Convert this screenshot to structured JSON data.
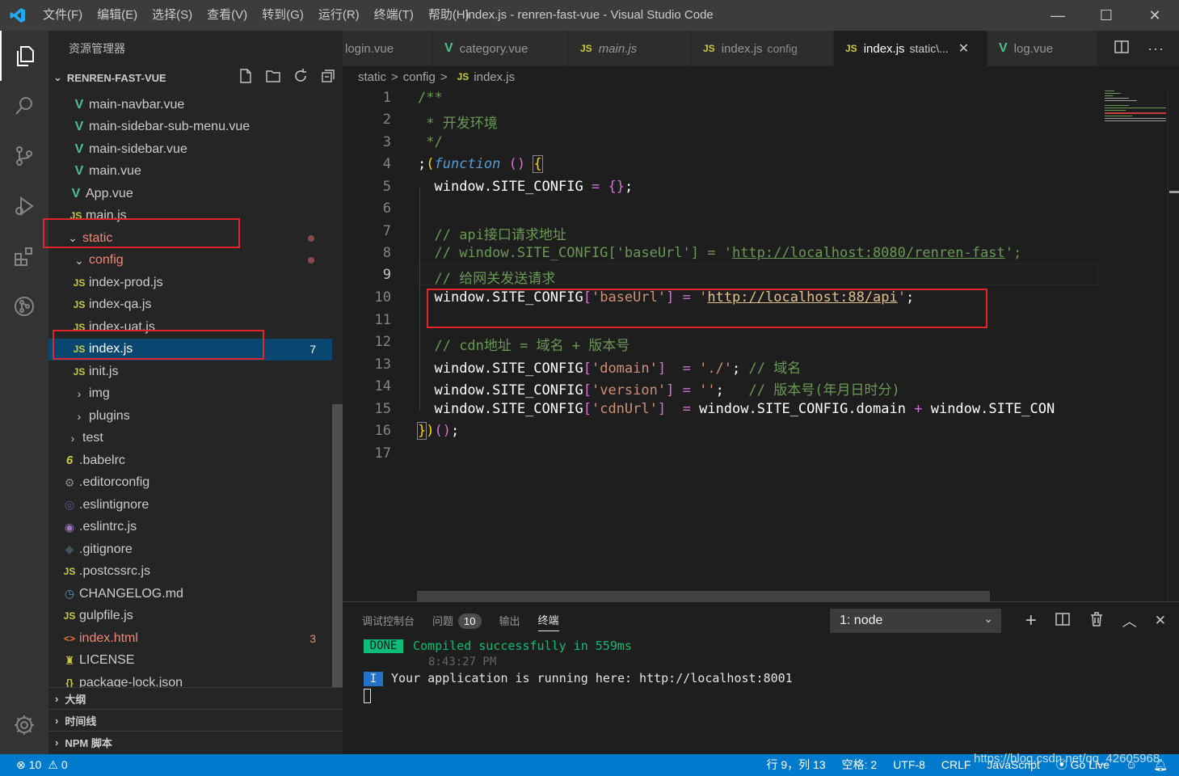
{
  "titlebar": {
    "menus": [
      "文件(F)",
      "编辑(E)",
      "选择(S)",
      "查看(V)",
      "转到(G)",
      "运行(R)",
      "终端(T)",
      "帮助(H)"
    ],
    "window_title": "index.js - renren-fast-vue - Visual Studio Code"
  },
  "activity": [
    "explorer-icon",
    "search-icon",
    "source-control-icon",
    "run-debug-icon",
    "extensions-icon",
    "git-graph-icon",
    "settings-gear-icon"
  ],
  "sidebar": {
    "header": "资源管理器",
    "project": "RENREN-FAST-VUE",
    "tree": [
      {
        "label": "main-navbar.vue",
        "icon": "V",
        "kind": "vue",
        "depth": 2
      },
      {
        "label": "main-sidebar-sub-menu.vue",
        "icon": "V",
        "kind": "vue",
        "depth": 2
      },
      {
        "label": "main-sidebar.vue",
        "icon": "V",
        "kind": "vue",
        "depth": 2
      },
      {
        "label": "main.vue",
        "icon": "V",
        "kind": "vue",
        "depth": 2
      },
      {
        "label": "App.vue",
        "icon": "V",
        "kind": "vue",
        "depth": 1
      },
      {
        "label": "main.js",
        "icon": "JS",
        "kind": "js",
        "depth": 1
      },
      {
        "label": "static",
        "icon": "⌄",
        "kind": "folder-open",
        "depth": 0,
        "color": "#f48771",
        "dot": true
      },
      {
        "label": "config",
        "icon": "⌄",
        "kind": "folder-open",
        "depth": 1,
        "color": "#f48771",
        "dot": true
      },
      {
        "label": "index-prod.js",
        "icon": "JS",
        "kind": "js",
        "depth": 2
      },
      {
        "label": "index-qa.js",
        "icon": "JS",
        "kind": "js",
        "depth": 2
      },
      {
        "label": "index-uat.js",
        "icon": "JS",
        "kind": "js",
        "depth": 2
      },
      {
        "label": "index.js",
        "icon": "JS",
        "kind": "js",
        "depth": 2,
        "selected": true,
        "badge": "7"
      },
      {
        "label": "init.js",
        "icon": "JS",
        "kind": "js",
        "depth": 2
      },
      {
        "label": "img",
        "icon": "›",
        "kind": "folder",
        "depth": 1
      },
      {
        "label": "plugins",
        "icon": "›",
        "kind": "folder",
        "depth": 1
      },
      {
        "label": "test",
        "icon": "›",
        "kind": "folder",
        "depth": 0
      },
      {
        "label": ".babelrc",
        "icon": "6",
        "kind": "babel",
        "depth": 0
      },
      {
        "label": ".editorconfig",
        "icon": "⚙",
        "kind": "config",
        "depth": 0
      },
      {
        "label": ".eslintignore",
        "icon": "◎",
        "kind": "eslint-ignore",
        "depth": 0
      },
      {
        "label": ".eslintrc.js",
        "icon": "◉",
        "kind": "eslint",
        "depth": 0
      },
      {
        "label": ".gitignore",
        "icon": "◆",
        "kind": "git",
        "depth": 0
      },
      {
        "label": ".postcssrc.js",
        "icon": "JS",
        "kind": "js",
        "depth": 0
      },
      {
        "label": "CHANGELOG.md",
        "icon": "◷",
        "kind": "md",
        "depth": 0
      },
      {
        "label": "gulpfile.js",
        "icon": "JS",
        "kind": "js",
        "depth": 0
      },
      {
        "label": "index.html",
        "icon": "<>",
        "kind": "html",
        "depth": 0,
        "color": "#f48771",
        "badge": "3"
      },
      {
        "label": "LICENSE",
        "icon": "♜",
        "kind": "license",
        "depth": 0
      },
      {
        "label": "package-lock.json",
        "icon": "{}",
        "kind": "json",
        "depth": 0
      }
    ],
    "sections": [
      "大纲",
      "时间线",
      "NPM 脚本"
    ]
  },
  "tabs": [
    {
      "label": "login.vue",
      "icon": "",
      "active": false
    },
    {
      "label": "category.vue",
      "icon": "V",
      "active": false
    },
    {
      "label": "main.js",
      "icon": "JS",
      "active": false,
      "italic": true
    },
    {
      "label": "index.js",
      "detail": "config",
      "icon": "JS",
      "active": false
    },
    {
      "label": "index.js",
      "detail": "static\\...",
      "icon": "JS",
      "active": true
    },
    {
      "label": "log.vue",
      "icon": "V",
      "active": false
    }
  ],
  "breadcrumb": {
    "part1": "static",
    "part2": "config",
    "file": "index.js",
    "sep": ">"
  },
  "code": {
    "line_numbers": [
      "1",
      "2",
      "3",
      "4",
      "5",
      "6",
      "7",
      "8",
      "9",
      "10",
      "11",
      "12",
      "13",
      "14",
      "15",
      "16",
      "17"
    ]
  },
  "panel": {
    "tabs": [
      "调试控制台",
      "问题",
      "输出",
      "终端"
    ],
    "problems_count": "10",
    "terminal_select": "1: node",
    "done_label": "DONE",
    "compiled": "Compiled successfully in 559ms",
    "time": "8:43:27 PM",
    "info_label": "I",
    "running": "Your application is running here: http://localhost:8001"
  },
  "status": {
    "errors": "10",
    "warnings": "0",
    "position": "行 9，列 13",
    "spaces": "空格: 2",
    "encoding": "UTF-8",
    "eol": "CRLF",
    "language": "JavaScript",
    "golive": "Go Live",
    "watermark": "https://blog.csdn.net/qq_42605968"
  }
}
